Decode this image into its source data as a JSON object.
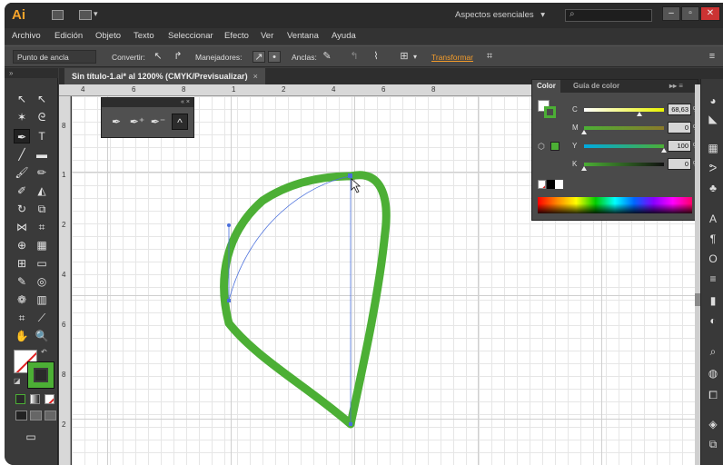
{
  "app": {
    "logo": "Ai",
    "workspace": "Aspectos esenciales",
    "workspace_chevron": "▾",
    "search_placeholder": "",
    "search_icon": "search-icon"
  },
  "menu": [
    "Archivo",
    "Edición",
    "Objeto",
    "Texto",
    "Seleccionar",
    "Efecto",
    "Ver",
    "Ventana",
    "Ayuda"
  ],
  "controlbar": {
    "selection_label": "Punto de ancla",
    "convert_label": "Convertir:",
    "handles_label": "Manejadores:",
    "anchors_label": "Anclas:",
    "transform_link": "Transformar"
  },
  "document": {
    "tab_title": "Sin título-1.ai* al 1200% (CMYK/Previsualizar)",
    "close": "×"
  },
  "ruler": {
    "top_numbers": [
      "4",
      "6",
      "8",
      "1",
      "2",
      "4",
      "6",
      "8"
    ],
    "left_numbers": [
      "8",
      "1",
      "2",
      "4",
      "6",
      "8",
      "2"
    ]
  },
  "pen_panel": {
    "collapse": "«",
    "close": "×",
    "tools": [
      "pen-tool-icon",
      "add-anchor-icon",
      "delete-anchor-icon",
      "convert-anchor-icon"
    ]
  },
  "color_panel": {
    "tabs": [
      "Color",
      "Guía de color"
    ],
    "menu": "▸▸ ≡",
    "sliders": [
      {
        "label": "C",
        "value": "68,63",
        "fraction": 0.69,
        "color": "#00a9e0"
      },
      {
        "label": "M",
        "value": "0",
        "fraction": 0.0,
        "color": "#e0007a"
      },
      {
        "label": "Y",
        "value": "100",
        "fraction": 1.0,
        "color": "#ffe600"
      },
      {
        "label": "K",
        "value": "0",
        "fraction": 0.0,
        "color": "#000000"
      }
    ],
    "percent": "%"
  },
  "colors": {
    "stroke_green": "#4caf35",
    "path_blue": "#4a6fdc",
    "accent_orange": "#f39c2b"
  }
}
